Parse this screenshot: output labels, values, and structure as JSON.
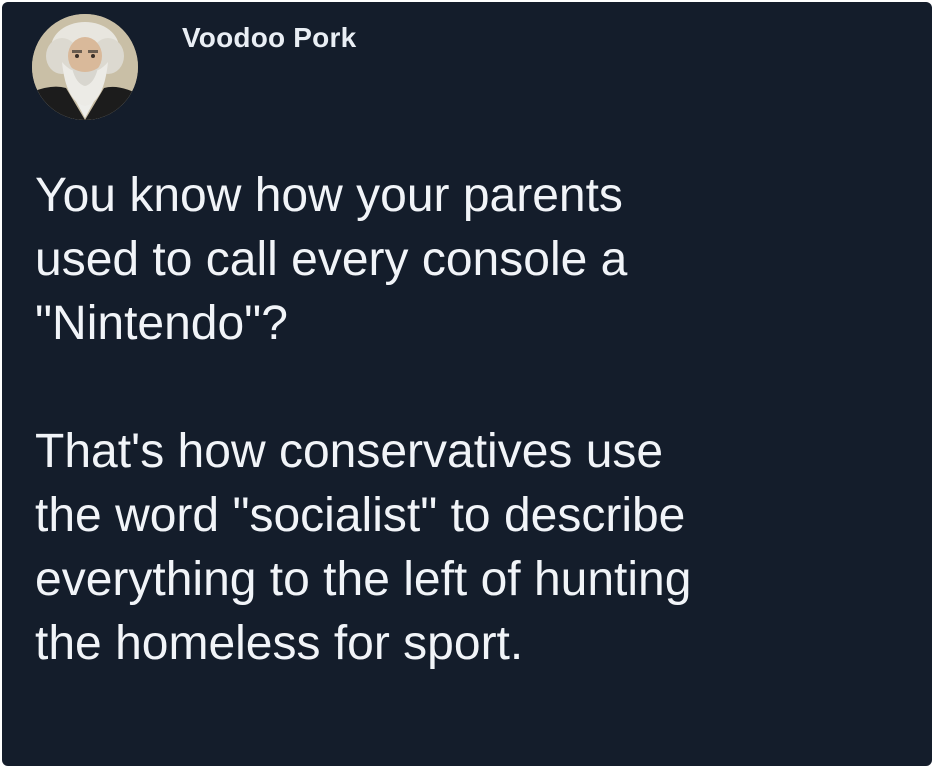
{
  "post": {
    "author": {
      "display_name": "Voodoo Pork",
      "avatar_icon": "bearded-man-portrait-icon"
    },
    "paragraphs": [
      "You know how your parents\nused to call every console a\n\"Nintendo\"?",
      "That's how conservatives use\nthe word \"socialist\" to describe\neverything to the left of hunting\nthe homeless for sport."
    ]
  },
  "colors": {
    "background": "#141d2b",
    "text": "#f1f4f8",
    "border": "#ffffff"
  }
}
